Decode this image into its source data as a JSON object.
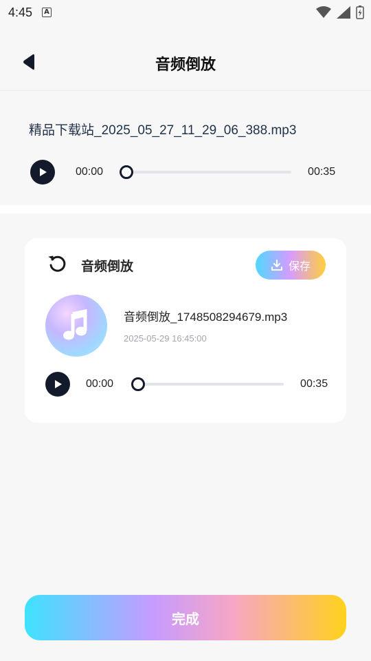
{
  "status_bar": {
    "time": "4:45",
    "notification_icon": "A",
    "icons": [
      "wifi-icon",
      "signal-icon",
      "battery-charging-icon"
    ]
  },
  "header": {
    "title": "音频倒放",
    "back_icon": "back-arrow-icon"
  },
  "source": {
    "file_name": "精品下载站_2025_05_27_11_29_06_388.mp3",
    "current_time": "00:00",
    "duration": "00:35",
    "progress": 0
  },
  "result": {
    "title": "音频倒放",
    "save_label": "保存",
    "file_name": "音频倒放_1748508294679.mp3",
    "date": "2025-05-29 16:45:00",
    "current_time": "00:00",
    "duration": "00:35",
    "progress": 0
  },
  "footer": {
    "done_label": "完成"
  },
  "colors": {
    "primary_dark": "#131a2c",
    "gradient_start": "#3ee2ff",
    "gradient_mid": "#c69bff",
    "gradient_end": "#ffd21c"
  }
}
